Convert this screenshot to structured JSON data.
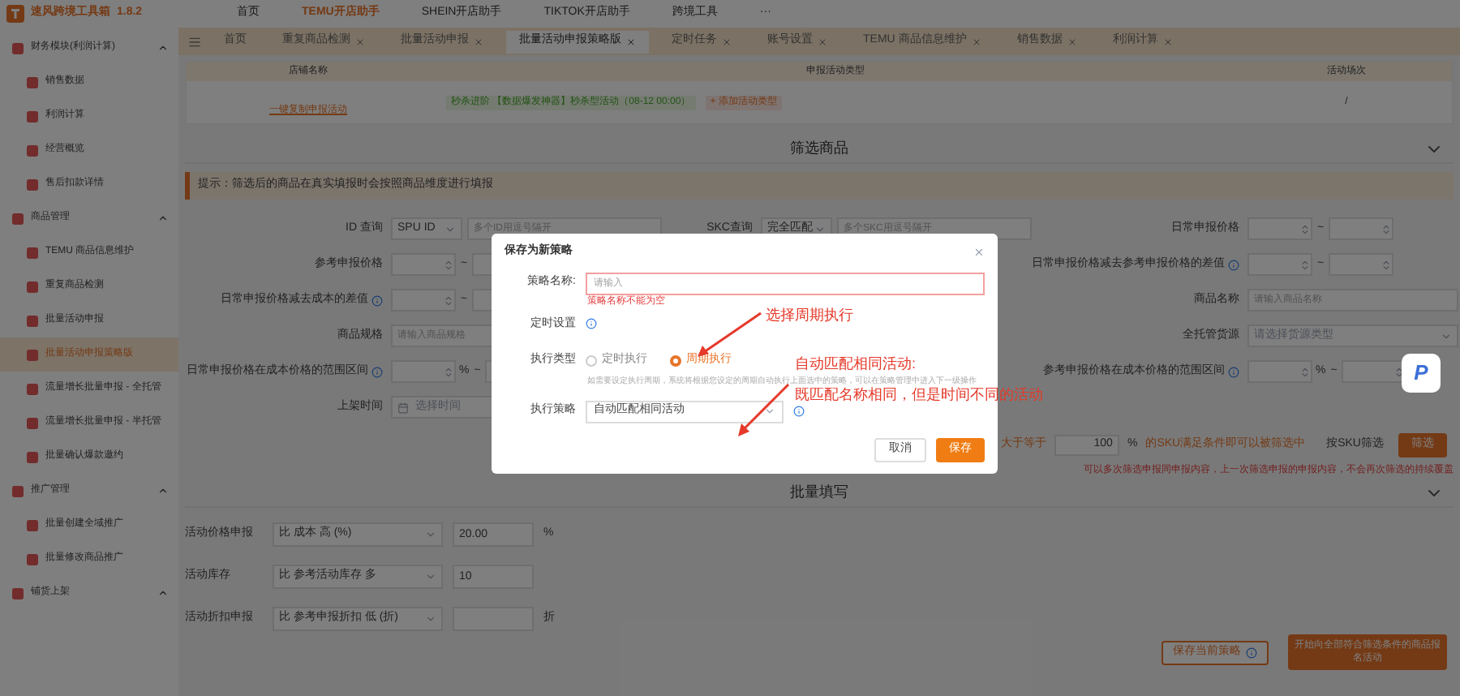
{
  "app": {
    "name": "速风跨境工具箱",
    "version": "1.8.2"
  },
  "top_nav": [
    {
      "label": "首页",
      "selected": false
    },
    {
      "label": "TEMU开店助手",
      "selected": true
    },
    {
      "label": "SHEIN开店助手",
      "selected": false
    },
    {
      "label": "TIKTOK开店助手",
      "selected": false
    },
    {
      "label": "跨境工具",
      "selected": false
    },
    {
      "label": "···",
      "selected": false
    }
  ],
  "sidebar": {
    "items": [
      {
        "label": "财务模块(利润计算)",
        "expanded": true,
        "selected": false,
        "children": [
          {
            "label": "销售数据",
            "selected": false
          },
          {
            "label": "利润计算",
            "selected": false
          },
          {
            "label": "经营概览",
            "selected": false
          },
          {
            "label": "售后扣款详情",
            "selected": false
          }
        ]
      },
      {
        "label": "商品管理",
        "expanded": true,
        "selected": false,
        "children": [
          {
            "label": "TEMU 商品信息维护",
            "selected": false
          },
          {
            "label": "重复商品检测",
            "selected": false
          },
          {
            "label": "批量活动申报",
            "selected": false
          },
          {
            "label": "批量活动申报策略版",
            "selected": true
          },
          {
            "label": "流量增长批量申报 - 全托管",
            "selected": false
          },
          {
            "label": "流量增长批量申报 - 半托管",
            "selected": false
          },
          {
            "label": "批量确认爆款邀约",
            "selected": false
          }
        ]
      },
      {
        "label": "推广管理",
        "expanded": true,
        "selected": false,
        "children": [
          {
            "label": "批量创建全域推广",
            "selected": false
          },
          {
            "label": "批量修改商品推广",
            "selected": false
          }
        ]
      },
      {
        "label": "铺货上架",
        "expanded": true,
        "selected": false
      }
    ]
  },
  "tabs": [
    {
      "label": "首页",
      "closable": false,
      "selected": false
    },
    {
      "label": "重复商品检测",
      "closable": true,
      "selected": false
    },
    {
      "label": "批量活动申报",
      "closable": true,
      "selected": false
    },
    {
      "label": "批量活动申报策略版",
      "closable": true,
      "selected": true
    },
    {
      "label": "定时任务",
      "closable": true,
      "selected": false
    },
    {
      "label": "账号设置",
      "closable": true,
      "selected": false
    },
    {
      "label": "TEMU 商品信息维护",
      "closable": true,
      "selected": false
    },
    {
      "label": "销售数据",
      "closable": true,
      "selected": false
    },
    {
      "label": "利润计算",
      "closable": true,
      "selected": false
    }
  ],
  "activity_table": {
    "columns": [
      "店铺名称",
      "申报活动类型",
      "活动场次"
    ],
    "row": {
      "copy_link": "一键复制申报活动",
      "activity_tag": "秒杀进阶 【数据爆发神器】秒杀型活动（08-12 00:00）",
      "add_button": "+ 添加活动类型",
      "session": "/"
    }
  },
  "filter_section": {
    "title": "筛选商品",
    "tip": "提示：筛选后的商品在真实填报时会按照商品维度进行填报",
    "rows": [
      {
        "left": {
          "label": "ID 查询",
          "kind": "select_input",
          "info": false,
          "select": "SPU ID",
          "placeholder": "多个ID用逗号隔开"
        },
        "middle": {
          "label": "SKC查询",
          "kind": "select_input",
          "info": false,
          "select": "完全匹配",
          "placeholder": "多个SKC用逗号隔开"
        },
        "right": {
          "label": "日常申报价格",
          "kind": "range",
          "info": false,
          "separator": "~"
        }
      },
      {
        "left": {
          "label": "参考申报价格",
          "kind": "range",
          "info": false,
          "separator": "~"
        },
        "right": {
          "label": "日常申报价格减去参考申报价格的差值",
          "kind": "range",
          "info": true,
          "separator": "~"
        }
      },
      {
        "left": {
          "label": "日常申报价格减去成本的差值",
          "kind": "range",
          "info": true,
          "separator": "~"
        },
        "right": {
          "label": "商品名称",
          "kind": "input",
          "info": false,
          "placeholder": "请输入商品名称"
        }
      },
      {
        "left": {
          "label": "商品规格",
          "kind": "input",
          "info": false,
          "placeholder": "请输入商品规格"
        },
        "right": {
          "label": "全托管货源",
          "kind": "select",
          "info": false,
          "placeholder": "请选择货源类型"
        }
      },
      {
        "left": {
          "label": "日常申报价格在成本价格的范围区间",
          "kind": "percent_range",
          "info": true,
          "unit": "%",
          "separator": "~"
        },
        "right": {
          "label": "参考申报价格在成本价格的范围区间",
          "kind": "percent_range",
          "info": true,
          "unit": "%",
          "separator": "~"
        }
      },
      {
        "left": {
          "label": "上架时间",
          "kind": "date",
          "info": false,
          "placeholder": "选择时间"
        }
      }
    ],
    "sku_rule": {
      "prefix": "大于等于",
      "value": "100",
      "unit": "%",
      "suffix": "的SKU满足条件即可以被筛选中",
      "sku_filter": "按SKU筛选",
      "filter_button": "筛选"
    },
    "note": "可以多次筛选申报同申报内容，上一次筛选申报的申报内容，不会再次筛选的持续覆盖"
  },
  "batch_section": {
    "title": "批量填写",
    "rows": [
      {
        "label": "活动价格申报",
        "select": "比 成本 高 (%)",
        "value": "20.00",
        "unit": "%"
      },
      {
        "label": "活动库存",
        "select": "比 参考活动库存 多",
        "value": "10"
      },
      {
        "label": "活动折扣申报",
        "select": "比 参考申报折扣 低 (折)",
        "unit": "折"
      }
    ],
    "save_button": "保存当前策略",
    "start_button": "开始向全部符合筛选条件的商品报名活动"
  },
  "modal": {
    "title": "保存为新策略",
    "name_label": "策略名称:",
    "name_placeholder": "请输入",
    "name_error": "策略名称不能为空",
    "schedule_label": "定时设置",
    "type_label": "执行类型",
    "type_options": [
      {
        "label": "定时执行",
        "selected": false
      },
      {
        "label": "周期执行",
        "selected": true
      }
    ],
    "type_hint": "如需要设定执行周期，系统将根据您设定的周期自动执行上面选中的策略，可以在策略管理中进入下一级操作",
    "strategy_label": "执行策略",
    "strategy_value": "自动匹配相同活动",
    "cancel": "取消",
    "save": "保存"
  },
  "annotations": [
    {
      "text": "选择周期执行"
    },
    {
      "text": "自动匹配相同活动:"
    },
    {
      "text": "既匹配名称相同，但是时间不同的活动"
    }
  ],
  "floating_button": {
    "label": "P"
  }
}
